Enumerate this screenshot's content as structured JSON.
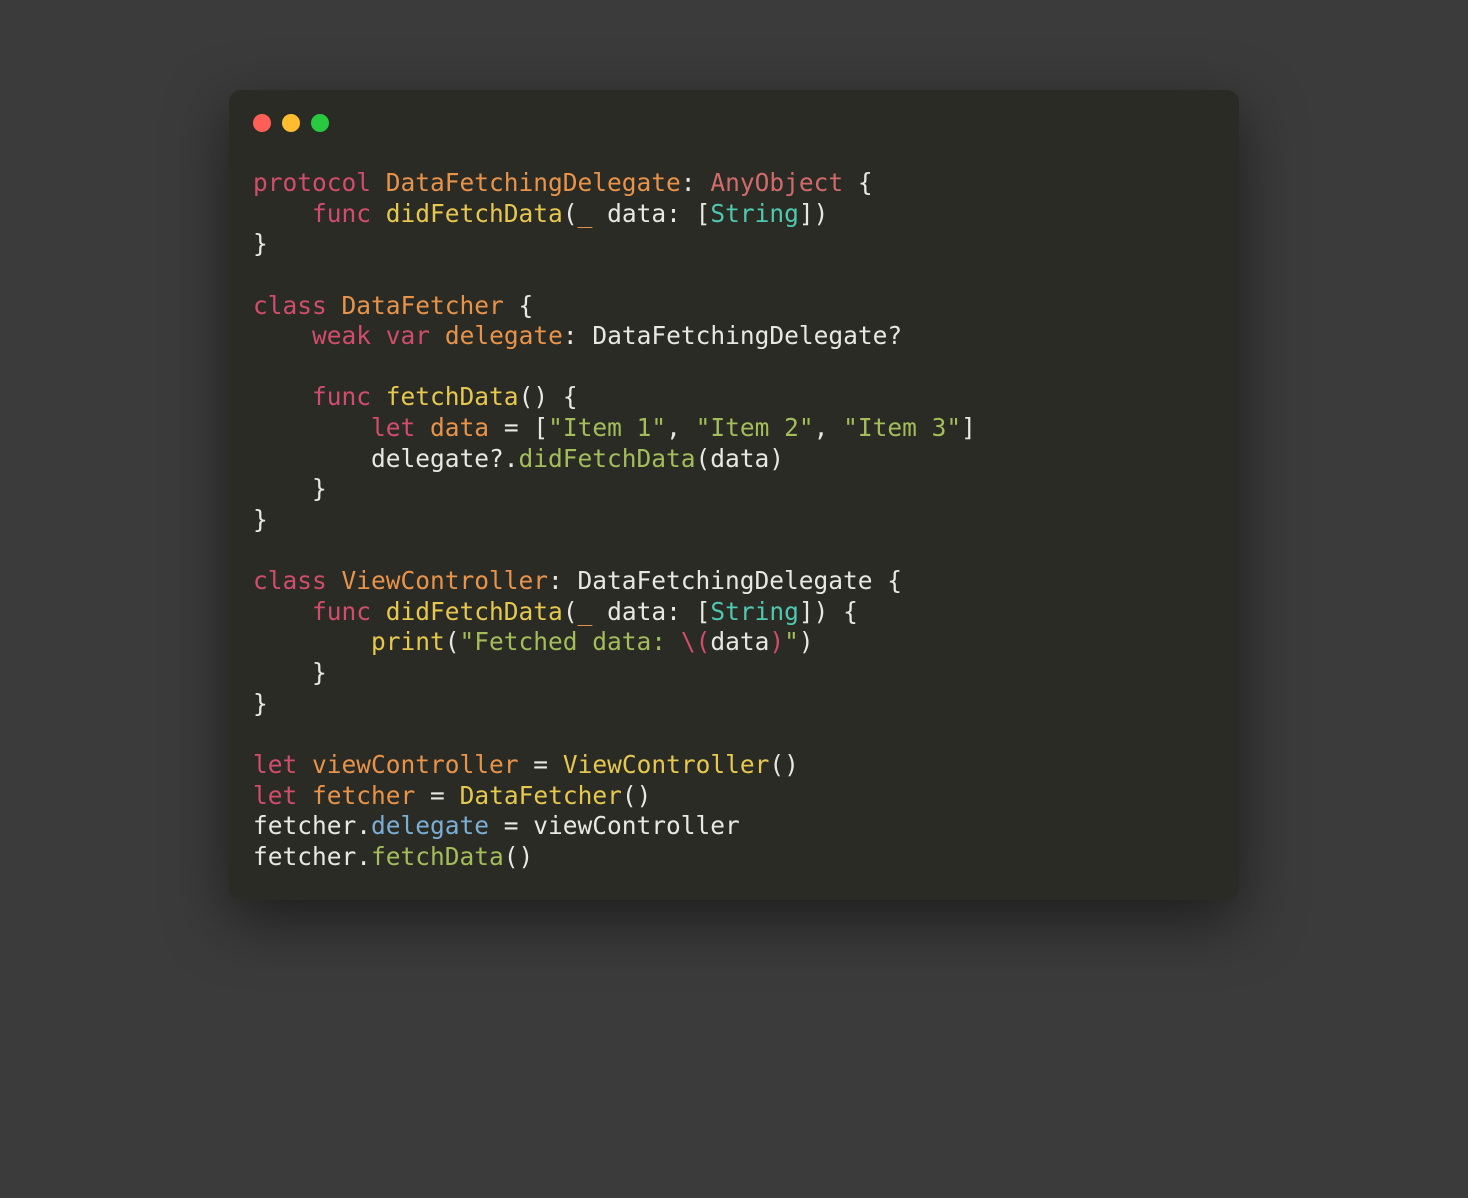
{
  "code": {
    "l1_protocol": "protocol",
    "l1_name": "DataFetchingDelegate",
    "l1_colon": ": ",
    "l1_any": "AnyObject",
    "l1_brace": " {",
    "l2_indent": "    ",
    "l2_func": "func",
    "l2_sp": " ",
    "l2_name": "didFetchData",
    "l2_open": "(",
    "l2_under": "_",
    "l2_param": " data: [",
    "l2_string": "String",
    "l2_close": "])",
    "l3_brace": "}",
    "l5_class": "class",
    "l5_sp": " ",
    "l5_name": "DataFetcher",
    "l5_brace": " {",
    "l6_indent": "    ",
    "l6_weak": "weak",
    "l6_sp1": " ",
    "l6_var": "var",
    "l6_sp2": " ",
    "l6_delegate": "delegate",
    "l6_rest": ": DataFetchingDelegate?",
    "l8_indent": "    ",
    "l8_func": "func",
    "l8_sp": " ",
    "l8_name": "fetchData",
    "l8_parens": "() {",
    "l9_indent": "        ",
    "l9_let": "let",
    "l9_sp": " ",
    "l9_data": "data",
    "l9_eq": " = [",
    "l9_s1": "\"Item 1\"",
    "l9_c1": ", ",
    "l9_s2": "\"Item 2\"",
    "l9_c2": ", ",
    "l9_s3": "\"Item 3\"",
    "l9_close": "]",
    "l10_indent": "        delegate?.",
    "l10_call": "didFetchData",
    "l10_args": "(data)",
    "l11_indent": "    }",
    "l12_brace": "}",
    "l14_class": "class",
    "l14_sp": " ",
    "l14_name": "ViewController",
    "l14_rest": ": DataFetchingDelegate {",
    "l15_indent": "    ",
    "l15_func": "func",
    "l15_sp": " ",
    "l15_name": "didFetchData",
    "l15_open": "(",
    "l15_under": "_",
    "l15_param": " data: [",
    "l15_string": "String",
    "l15_close": "]) {",
    "l16_indent": "        ",
    "l16_print": "print",
    "l16_open": "(",
    "l16_str1": "\"Fetched data: ",
    "l16_interp_open": "\\(",
    "l16_data": "data",
    "l16_interp_close": ")",
    "l16_str2": "\"",
    "l16_close": ")",
    "l17_indent": "    }",
    "l18_brace": "}",
    "l20_let": "let",
    "l20_sp": " ",
    "l20_vc": "viewController",
    "l20_eq": " = ",
    "l20_ctor": "ViewController",
    "l20_parens": "()",
    "l21_let": "let",
    "l21_sp": " ",
    "l21_f": "fetcher",
    "l21_eq": " = ",
    "l21_ctor": "DataFetcher",
    "l21_parens": "()",
    "l22_f": "fetcher.",
    "l22_del": "delegate",
    "l22_rest": " = viewController",
    "l23_f": "fetcher.",
    "l23_call": "fetchData",
    "l23_parens": "()"
  }
}
